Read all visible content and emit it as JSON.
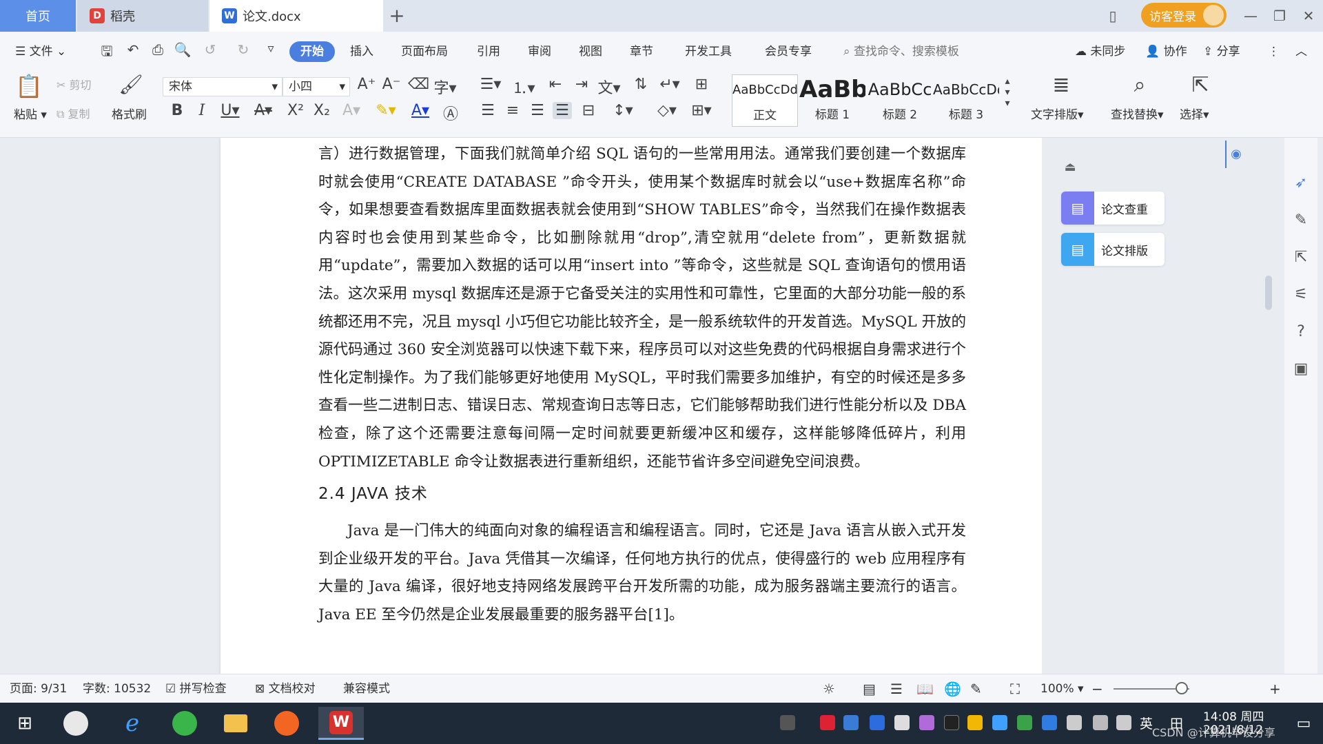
{
  "tabs": {
    "home": "首页",
    "daoke": "稻壳",
    "document": "论文.docx",
    "new_tab_icon": "plus-icon"
  },
  "window": {
    "visitor_login": "访客登录"
  },
  "menu": {
    "file": "文件",
    "items": [
      "开始",
      "插入",
      "页面布局",
      "引用",
      "审阅",
      "视图",
      "章节",
      "开发工具",
      "会员专享"
    ],
    "active": "开始",
    "search_placeholder": "查找命令、搜索模板",
    "not_synced": "未同步",
    "collaborate": "协作",
    "share": "分享"
  },
  "ribbon": {
    "paste": "粘贴",
    "cut": "剪切",
    "copy": "复制",
    "format_painter": "格式刷",
    "font_name": "宋体",
    "font_size": "小四",
    "styles": [
      {
        "sample": "AaBbCcDd",
        "label": "正文"
      },
      {
        "sample": "AaBb",
        "label": "标题 1"
      },
      {
        "sample": "AaBbCc",
        "label": "标题 2"
      },
      {
        "sample": "AaBbCcDd",
        "label": "标题 3"
      }
    ],
    "text_layout": "文字排版",
    "find_replace": "查找替换",
    "select": "选择"
  },
  "document": {
    "para1": "言）进行数据管理，下面我们就简单介绍 SQL 语句的一些常用用法。通常我们要创建一个数据库时就会使用“CREATE DATABASE ”命令开头，使用某个数据库时就会以“use+数据库名称”命令，如果想要查看数据库里面数据表就会使用到“SHOW TABLES”命令，当然我们在操作数据表内容时也会使用到某些命令，比如删除就用“drop”,清空就用“delete from”，更新数据就用“update”，需要加入数据的话可以用“insert into ”等命令，这些就是 SQL 查询语句的惯用语法。这次采用 mysql 数据库还是源于它备受关注的实用性和可靠性，它里面的大部分功能一般的系统都还用不完，况且 mysql 小巧但它功能比较齐全，是一般系统软件的开发首选。MySQL 开放的源代码通过 360 安全浏览器可以快速下载下来，程序员可以对这些免费的代码根据自身需求进行个性化定制操作。为了我们能够更好地使用 MySQL，平时我们需要多加维护，有空的时候还是多多查看一些二进制日志、错误日志、常规查询日志等日志，它们能够帮助我们进行性能分析以及 DBA 检查，除了这个还需要注意每间隔一定时间就要更新缓冲区和缓存，这样能够降低碎片，利用 OPTIMIZETABLE 命令让数据表进行重新组织，还能节省许多空间避免空间浪费。",
    "heading": "2.4 JAVA 技术",
    "para2": "Java 是一门伟大的纯面向对象的编程语言和编程语言。同时，它还是 Java 语言从嵌入式开发到企业级开发的平台。Java 凭借其一次编译，任何地方执行的优点，使得盛行的 web 应用程序有大量的 Java 编译，很好地支持网络发展跨平台开发所需的功能，成为服务器端主要流行的语言。Java EE 至今仍然是企业发展最重要的服务器平台[1]。"
  },
  "side_panel": {
    "check": "论文查重",
    "layout": "论文排版"
  },
  "status": {
    "page": "页面: 9/31",
    "words": "字数: 10532",
    "spell_check": "拼写检查",
    "doc_proof": "文档校对",
    "compat_mode": "兼容模式",
    "zoom": "100%"
  },
  "taskbar": {
    "time": "14:08 周四",
    "date": "2021/8/12",
    "ime_lang": "英",
    "ime_mode": "田",
    "watermark": "CSDN @计算机毕设分享"
  },
  "colors": {
    "accent": "#4a7fe0",
    "tab_home": "#5b8fe8",
    "login": "#f0a020",
    "taskbar": "#1f2a38"
  }
}
